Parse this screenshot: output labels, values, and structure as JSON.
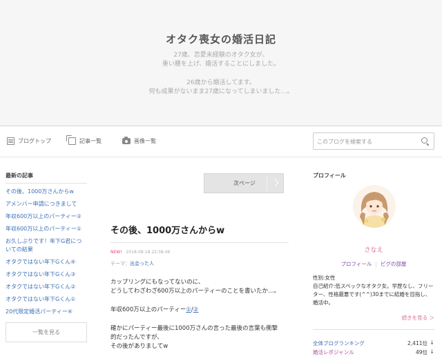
{
  "header": {
    "title": "オタク喪女の婚活日記",
    "desc_line1": "27歳、恋愛未経験のオタク女が、",
    "desc_line2": "重い腰を上げ、婚活することにしました。",
    "desc_line3": "26歳から婚活してます。",
    "desc_line4": "何も成果がないまま27歳になってしまいました…。"
  },
  "nav": {
    "blog_top": "ブログトップ",
    "article_list": "記事一覧",
    "image_list": "画像一覧",
    "search_placeholder": "このブログを検索する"
  },
  "sidebar_left": {
    "heading": "最新の記事",
    "items": [
      "その後、1000万さんからw",
      "アメンバー申請につきまして",
      "年収600万以上のパーティー②",
      "年収600万以上のパーティー①",
      "お久しぶりです！年下G君についての結果",
      "オタクではない年下Gくん④",
      "オタクではない年下Gくん③",
      "オタクではない年下Gくん②",
      "オタクではない年下Gくん①",
      "20代限定婚活パーティー④"
    ],
    "more_button": "一覧を見る"
  },
  "main": {
    "next_page": "次ページ",
    "post_title": "その後、1000万さんからw",
    "new_badge": "NEW!",
    "timestamp": "2018-08-18 22:38:46",
    "theme_label": "テーマ：",
    "theme_value": "出会った人",
    "body_line1": "カップリングにもなってないのに、",
    "body_line2": "どうしてわざわざ600万以上のパーティーのことを書いたか…。",
    "body_line3_prefix": "年収600万以上のパーティー",
    "body_link1": "①",
    "body_slash": "/",
    "body_link2": "②",
    "body_line4": "確かにパーティー最後に1000万さんの言った最後の言葉も衝撃",
    "body_line5": "的だったんですが、",
    "body_line6": "その後がありましてw"
  },
  "sidebar_right": {
    "heading": "プロフィール",
    "name": "さなえ",
    "profile_link": "プロフィール",
    "room_link": "ピグの部屋",
    "gender": "性別:女性",
    "intro": "自己紹介:低スペックなオタク女。学歴なし、フリーター、性格最悪です(^^)30までに結婚を目指し、婚活中。",
    "read_more": "続きを見る ＞",
    "rankings": [
      {
        "label": "全体ブログランキング",
        "value": "2,411位",
        "arrow": "↓"
      },
      {
        "label": "婚活レポジャンル",
        "value": "49位",
        "arrow": "↓"
      }
    ]
  },
  "colors": {
    "link_blue": "#3b6fb6",
    "accent_pink": "#d9709a",
    "new_badge": "#e0457b",
    "header_bg": "#f6f6f6"
  }
}
